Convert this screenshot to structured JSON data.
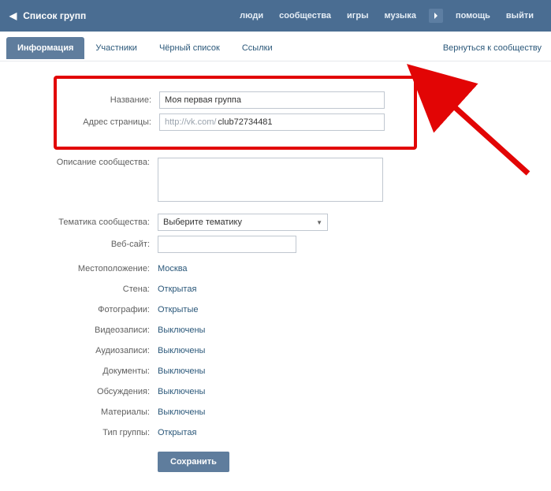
{
  "topbar": {
    "title": "Список групп",
    "nav": {
      "people": "люди",
      "communities": "сообщества",
      "games": "игры",
      "music": "музыка",
      "help": "помощь",
      "logout": "выйти"
    }
  },
  "tabs": {
    "info": "Информация",
    "members": "Участники",
    "blacklist": "Чёрный список",
    "links": "Ссылки",
    "return": "Вернуться к сообществу"
  },
  "form": {
    "name_label": "Название:",
    "name_value": "Моя первая группа",
    "address_label": "Адрес страницы:",
    "address_prefix": "http://vk.com/",
    "address_value": "club72734481",
    "desc_label": "Описание сообщества:",
    "desc_value": "",
    "topic_label": "Тематика сообщества:",
    "topic_value": "Выберите тематику",
    "website_label": "Веб-сайт:",
    "website_value": ""
  },
  "settings": {
    "location_label": "Местоположение:",
    "location_value": "Москва",
    "wall_label": "Стена:",
    "wall_value": "Открытая",
    "photos_label": "Фотографии:",
    "photos_value": "Открытые",
    "videos_label": "Видеозаписи:",
    "videos_value": "Выключены",
    "audio_label": "Аудиозаписи:",
    "audio_value": "Выключены",
    "docs_label": "Документы:",
    "docs_value": "Выключены",
    "discussions_label": "Обсуждения:",
    "discussions_value": "Выключены",
    "materials_label": "Материалы:",
    "materials_value": "Выключены",
    "type_label": "Тип группы:",
    "type_value": "Открытая"
  },
  "buttons": {
    "save": "Сохранить"
  },
  "colors": {
    "accent": "#5f7d9d",
    "highlight": "#e20505",
    "link": "#2b587a"
  }
}
